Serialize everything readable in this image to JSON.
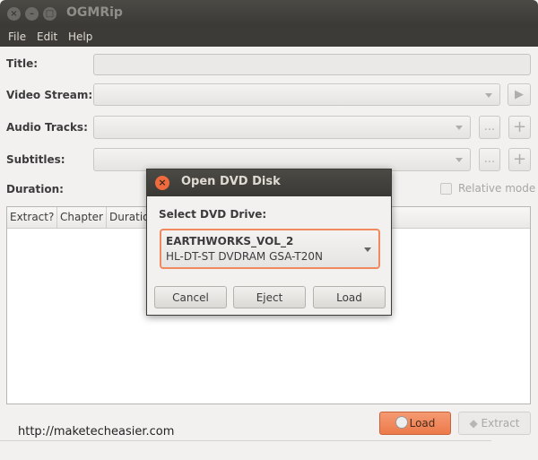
{
  "window": {
    "title": "OGMRip",
    "controls": [
      "close",
      "minimize",
      "maximize"
    ]
  },
  "menu": [
    "File",
    "Edit",
    "Help"
  ],
  "form": {
    "title_label": "Title:",
    "title_value": "",
    "video_label": "Video Stream:",
    "audio_label": "Audio Tracks:",
    "subtitles_label": "Subtitles:",
    "duration_label": "Duration:",
    "relative_mode": "Relative mode",
    "relative_checked": false,
    "more_label": "..."
  },
  "table": {
    "columns": [
      "Extract?",
      "Chapter",
      "Duration"
    ]
  },
  "buttons": {
    "load": "Load",
    "extract": "Extract"
  },
  "watermark": "http://maketecheasier.com",
  "dialog": {
    "title": "Open DVD Disk",
    "select_label": "Select DVD Drive:",
    "drive_name": "EARTHWORKS_VOL_2",
    "drive_model": "HL-DT-ST DVDRAM GSA-T20N",
    "cancel": "Cancel",
    "eject": "Eject",
    "load": "Load"
  },
  "colors": {
    "accent": "#f07746",
    "titlebar": "#3c3b37"
  }
}
